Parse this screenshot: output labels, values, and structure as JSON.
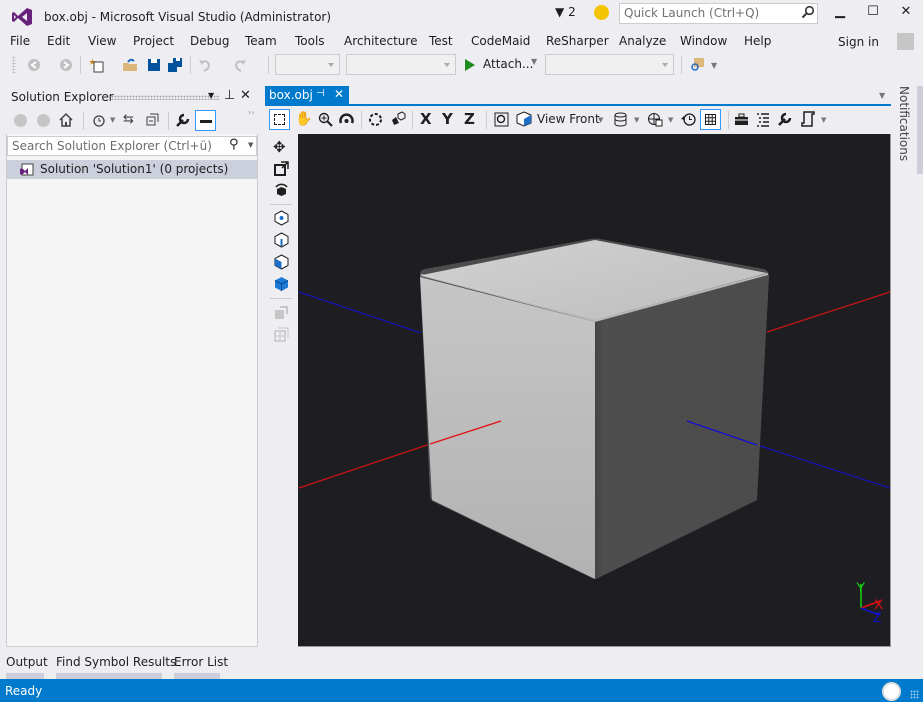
{
  "window": {
    "title": "box.obj - Microsoft Visual Studio (Administrator)",
    "filter_count": "2",
    "quick_launch_placeholder": "Quick Launch (Ctrl+Q)",
    "sign_in": "Sign in",
    "controls": {
      "minimize": "▁",
      "maximize": "☐",
      "close": "✕"
    }
  },
  "menu": [
    "File",
    "Edit",
    "View",
    "Project",
    "Debug",
    "Team",
    "Tools",
    "Architecture",
    "Test",
    "CodeMaid",
    "ReSharper",
    "Analyze",
    "Window",
    "Help"
  ],
  "toolbar": {
    "attach_label": "Attach...",
    "icons": [
      "back-icon",
      "forward-icon",
      "new-project-icon",
      "open-file-icon",
      "save-icon",
      "save-all-icon",
      "undo-icon",
      "redo-icon",
      "start-icon",
      "find-in-files-icon"
    ]
  },
  "solution_explorer": {
    "title": "Solution Explorer",
    "search_placeholder": "Search Solution Explorer (Ctrl+ü)",
    "tree": [
      {
        "label": "Solution 'Solution1' (0 projects)",
        "selected": true
      }
    ]
  },
  "document": {
    "tab_label": "box.obj",
    "view_label": "View Front"
  },
  "notifications_label": "Notifications",
  "bottom_tabs": [
    "Output",
    "Find Symbol Results",
    "Error List"
  ],
  "status": {
    "text": "Ready"
  },
  "axis_gizmo": {
    "x": "X",
    "y": "Y",
    "z": "Z"
  },
  "colors": {
    "accent": "#007acc",
    "vs_purple": "#68217a",
    "axis_x": "#e01010",
    "axis_y": "#10d010",
    "axis_z": "#1010d0"
  }
}
